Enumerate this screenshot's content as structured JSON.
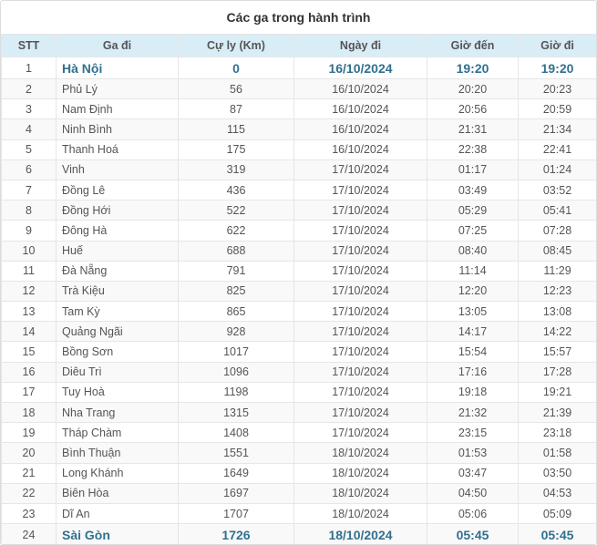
{
  "title": "Các ga trong hành trình",
  "columns": [
    "STT",
    "Ga đi",
    "Cự ly (Km)",
    "Ngày đi",
    "Giờ đến",
    "Giờ đi"
  ],
  "rows": [
    {
      "stt": "1",
      "name": "Hà Nội",
      "dist": "0",
      "date": "16/10/2024",
      "arr": "19:20",
      "dep": "19:20",
      "highlight": true
    },
    {
      "stt": "2",
      "name": "Phủ Lý",
      "dist": "56",
      "date": "16/10/2024",
      "arr": "20:20",
      "dep": "20:23"
    },
    {
      "stt": "3",
      "name": "Nam Định",
      "dist": "87",
      "date": "16/10/2024",
      "arr": "20:56",
      "dep": "20:59"
    },
    {
      "stt": "4",
      "name": "Ninh Bình",
      "dist": "115",
      "date": "16/10/2024",
      "arr": "21:31",
      "dep": "21:34"
    },
    {
      "stt": "5",
      "name": "Thanh Hoá",
      "dist": "175",
      "date": "16/10/2024",
      "arr": "22:38",
      "dep": "22:41"
    },
    {
      "stt": "6",
      "name": "Vinh",
      "dist": "319",
      "date": "17/10/2024",
      "arr": "01:17",
      "dep": "01:24"
    },
    {
      "stt": "7",
      "name": "Đồng Lê",
      "dist": "436",
      "date": "17/10/2024",
      "arr": "03:49",
      "dep": "03:52"
    },
    {
      "stt": "8",
      "name": "Đồng Hới",
      "dist": "522",
      "date": "17/10/2024",
      "arr": "05:29",
      "dep": "05:41"
    },
    {
      "stt": "9",
      "name": "Đông Hà",
      "dist": "622",
      "date": "17/10/2024",
      "arr": "07:25",
      "dep": "07:28"
    },
    {
      "stt": "10",
      "name": "Huế",
      "dist": "688",
      "date": "17/10/2024",
      "arr": "08:40",
      "dep": "08:45"
    },
    {
      "stt": "11",
      "name": "Đà Nẵng",
      "dist": "791",
      "date": "17/10/2024",
      "arr": "11:14",
      "dep": "11:29"
    },
    {
      "stt": "12",
      "name": "Trà Kiệu",
      "dist": "825",
      "date": "17/10/2024",
      "arr": "12:20",
      "dep": "12:23"
    },
    {
      "stt": "13",
      "name": "Tam Kỳ",
      "dist": "865",
      "date": "17/10/2024",
      "arr": "13:05",
      "dep": "13:08"
    },
    {
      "stt": "14",
      "name": "Quảng Ngãi",
      "dist": "928",
      "date": "17/10/2024",
      "arr": "14:17",
      "dep": "14:22"
    },
    {
      "stt": "15",
      "name": "Bồng Sơn",
      "dist": "1017",
      "date": "17/10/2024",
      "arr": "15:54",
      "dep": "15:57"
    },
    {
      "stt": "16",
      "name": "Diêu Trì",
      "dist": "1096",
      "date": "17/10/2024",
      "arr": "17:16",
      "dep": "17:28"
    },
    {
      "stt": "17",
      "name": "Tuy Hoà",
      "dist": "1198",
      "date": "17/10/2024",
      "arr": "19:18",
      "dep": "19:21"
    },
    {
      "stt": "18",
      "name": "Nha Trang",
      "dist": "1315",
      "date": "17/10/2024",
      "arr": "21:32",
      "dep": "21:39"
    },
    {
      "stt": "19",
      "name": "Tháp Chàm",
      "dist": "1408",
      "date": "17/10/2024",
      "arr": "23:15",
      "dep": "23:18"
    },
    {
      "stt": "20",
      "name": "Bình Thuận",
      "dist": "1551",
      "date": "18/10/2024",
      "arr": "01:53",
      "dep": "01:58"
    },
    {
      "stt": "21",
      "name": "Long Khánh",
      "dist": "1649",
      "date": "18/10/2024",
      "arr": "03:47",
      "dep": "03:50"
    },
    {
      "stt": "22",
      "name": "Biên Hòa",
      "dist": "1697",
      "date": "18/10/2024",
      "arr": "04:50",
      "dep": "04:53"
    },
    {
      "stt": "23",
      "name": "Dĩ An",
      "dist": "1707",
      "date": "18/10/2024",
      "arr": "05:06",
      "dep": "05:09"
    },
    {
      "stt": "24",
      "name": "Sài Gòn",
      "dist": "1726",
      "date": "18/10/2024",
      "arr": "05:45",
      "dep": "05:45",
      "highlight": true
    }
  ],
  "colors": {
    "header_bg": "#d9edf7",
    "highlight_text": "#31708f",
    "border": "#e6e6e6"
  }
}
